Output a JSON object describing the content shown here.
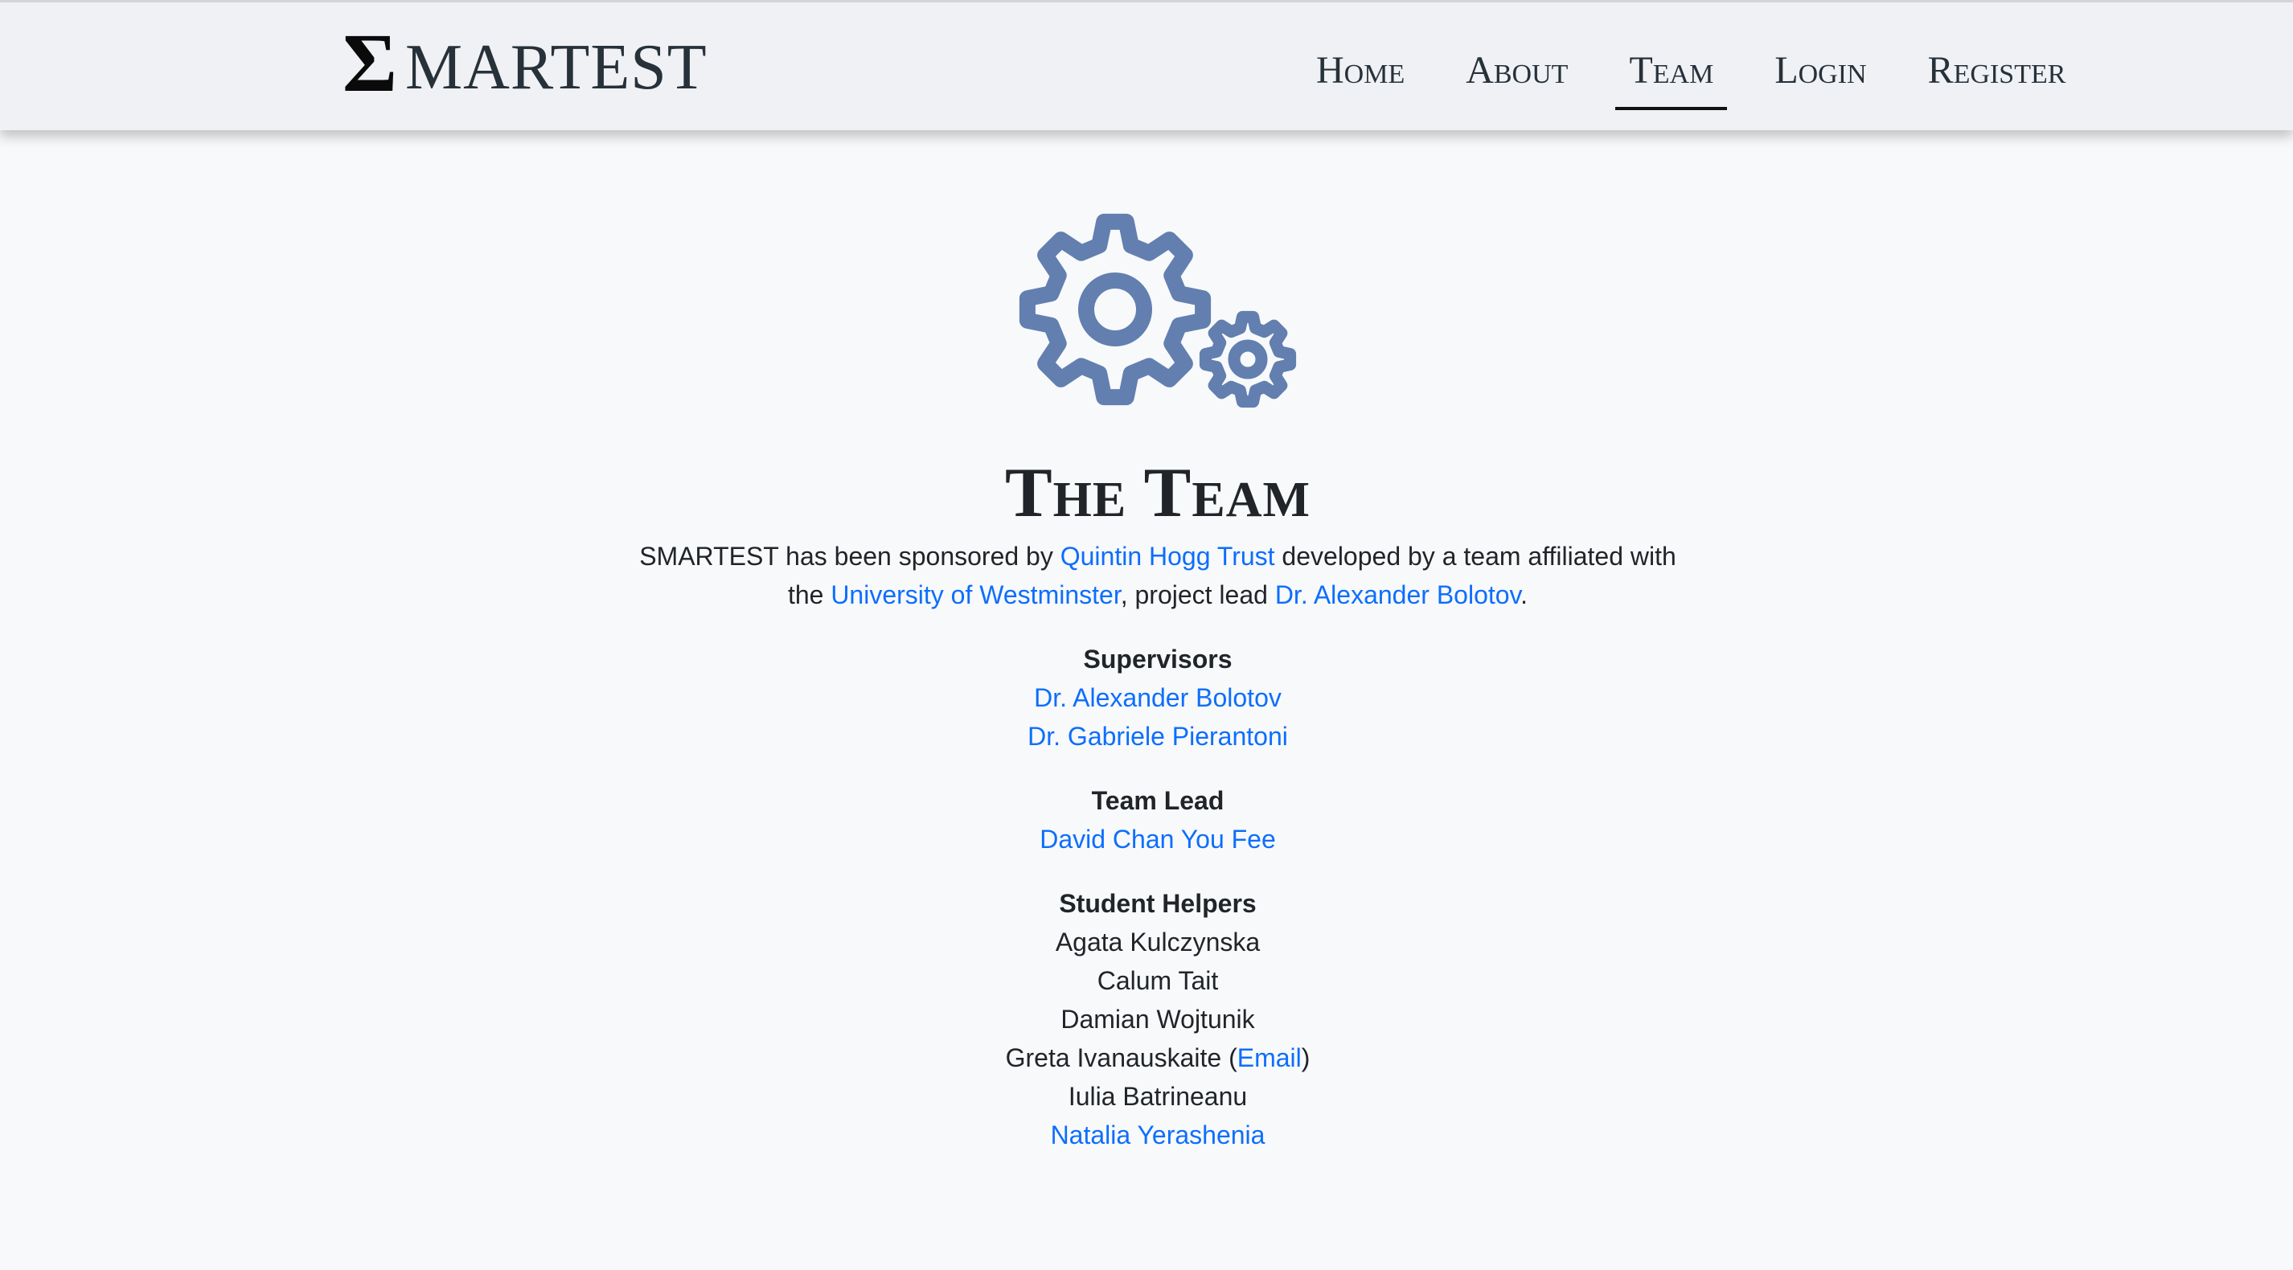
{
  "brand": {
    "sigma": "Σ",
    "name": "MARTEST"
  },
  "nav": [
    {
      "label": "Home"
    },
    {
      "label": "About"
    },
    {
      "label": "Team"
    },
    {
      "label": "Login"
    },
    {
      "label": "Register"
    }
  ],
  "colors": {
    "gear": "#627fb0",
    "link": "#0d6efd"
  },
  "title": "The Team",
  "intro": {
    "t1": "SMARTEST has been sponsored by ",
    "l1": "Quintin Hogg Trust",
    "t2": " developed by a team affiliated with the ",
    "l2": "University of Westminster",
    "t3": ", project lead ",
    "l3": "Dr. Alexander Bolotov",
    "t4": "."
  },
  "supervisors": {
    "title": "Supervisors",
    "people": [
      "Dr. Alexander Bolotov",
      "Dr. Gabriele Pierantoni"
    ]
  },
  "team_lead": {
    "title": "Team Lead",
    "people": [
      "David Chan You Fee"
    ]
  },
  "helpers": {
    "title": "Student Helpers",
    "people": [
      "Agata Kulczynska",
      "Calum Tait",
      "Damian Wojtunik",
      "Greta Ivanauskaite",
      "Iulia Batrineanu",
      "Natalia Yerashenia"
    ],
    "email_label": "Email",
    "paren_open": " (",
    "paren_close": ")"
  }
}
